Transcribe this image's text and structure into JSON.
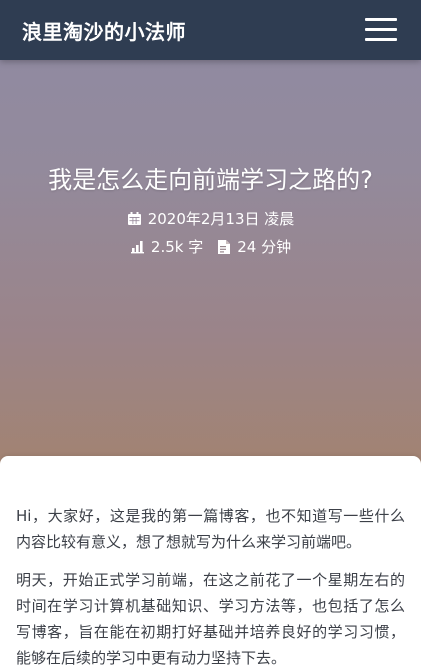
{
  "navbar": {
    "brand": "浪里淘沙的小法师",
    "menu_icon": "hamburger-menu-icon"
  },
  "post": {
    "title": "我是怎么走向前端学习之路的?",
    "date_icon": "calendar-icon",
    "date": "2020年2月13日 凌晨",
    "wordcount_icon": "bar-chart-icon",
    "wordcount": "2.5k 字",
    "readtime_icon": "document-icon",
    "readtime": "24 分钟"
  },
  "content": {
    "paragraphs": [
      "Hi，大家好，这是我的第一篇博客，也不知道写一些什么内容比较有意义，想了想就写为什么来学习前端吧。",
      "明天，开始正式学习前端，在这之前花了一个星期左右的时间在学习计算机基础知识、学习方法等，也包括了怎么写博客，旨在能在初期打好基础并培养良好的学习习惯，能够在后续的学习中更有动力坚持下去。"
    ]
  },
  "colors": {
    "navbar": "#2f3d52",
    "hero_top": "#8f8aa3",
    "hero_bottom": "#a3836f",
    "text": "#3c4048"
  }
}
